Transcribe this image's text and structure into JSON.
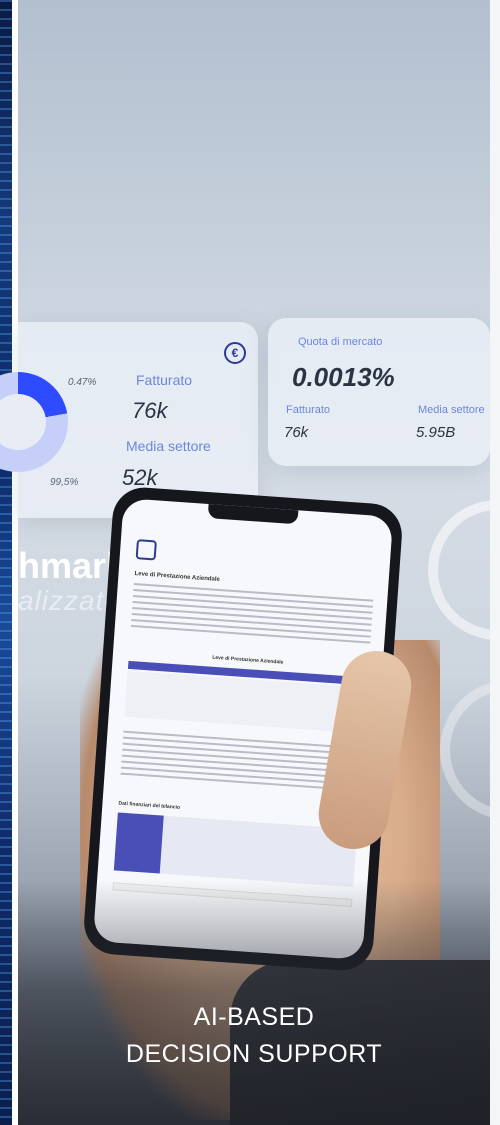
{
  "left_card": {
    "pct_top": "0.47%",
    "pct_bottom": "99,5%",
    "revenue_label": "Fatturato",
    "revenue_value": "76k",
    "sector_label": "Media settore",
    "sector_value": "52k",
    "currency_symbol": "€"
  },
  "right_card": {
    "title": "Quota di mercato",
    "share_value": "0.0013%",
    "revenue_label": "Fatturato",
    "sector_label": "Media settore",
    "revenue_value": "76k",
    "sector_value": "5.95B"
  },
  "overlay": {
    "word1": "hmark",
    "word2": "alizzato"
  },
  "document": {
    "heading": "Leve di Prestazione Aziendale",
    "table_heading": "Leve di Prestazione Aziendale",
    "financial_heading": "Dati finanziari del bilancio"
  },
  "caption": {
    "line1": "AI-BASED",
    "line2": "DECISION SUPPORT"
  },
  "colors": {
    "accent": "#2f4bff",
    "label_blue": "#6d86d9",
    "table_header": "#4a4fb8"
  },
  "icons": [
    "euro-icon",
    "document-logo-icon"
  ]
}
